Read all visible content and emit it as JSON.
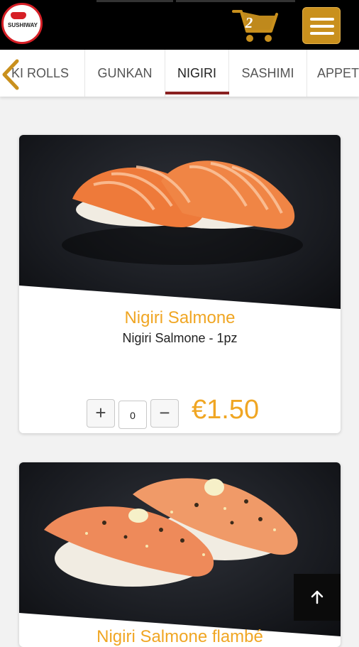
{
  "header": {
    "logo_text": "SUSHIWAY",
    "cart_count": "2",
    "icons": {
      "cart": "shopping-cart-icon",
      "menu": "hamburger-menu-icon"
    },
    "brand_color": "#c9901d"
  },
  "tabs": {
    "items": [
      {
        "label": "KI ROLLS"
      },
      {
        "label": "GUNKAN"
      },
      {
        "label": "NIGIRI"
      },
      {
        "label": "SASHIMI"
      },
      {
        "label": "APPET"
      }
    ],
    "active": "NIGIRI",
    "underline_color": "#8a2121"
  },
  "products": [
    {
      "title": "Nigiri Salmone",
      "subtitle": "Nigiri Salmone - 1pz",
      "quantity": "0",
      "price": "€1.50",
      "plus_label": "+",
      "minus_label": "−"
    },
    {
      "title": "Nigiri Salmone flambé"
    }
  ],
  "accent_color": "#f0a623"
}
